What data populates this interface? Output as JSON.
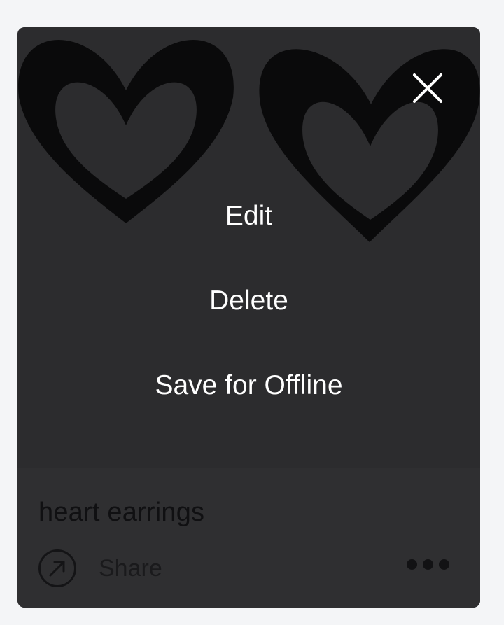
{
  "card": {
    "title": "heart earrings",
    "share_label": "Share"
  },
  "overlay_menu": {
    "items": [
      "Edit",
      "Delete",
      "Save for Offline"
    ]
  },
  "icons": {
    "close": "close-icon",
    "share": "share-arrow-icon",
    "more": "more-dots-icon"
  },
  "colors": {
    "overlay": "#2c2c2e",
    "hearts": "#0a0a0b",
    "menu_text": "#ffffff",
    "page_bg": "#f4f5f7"
  }
}
